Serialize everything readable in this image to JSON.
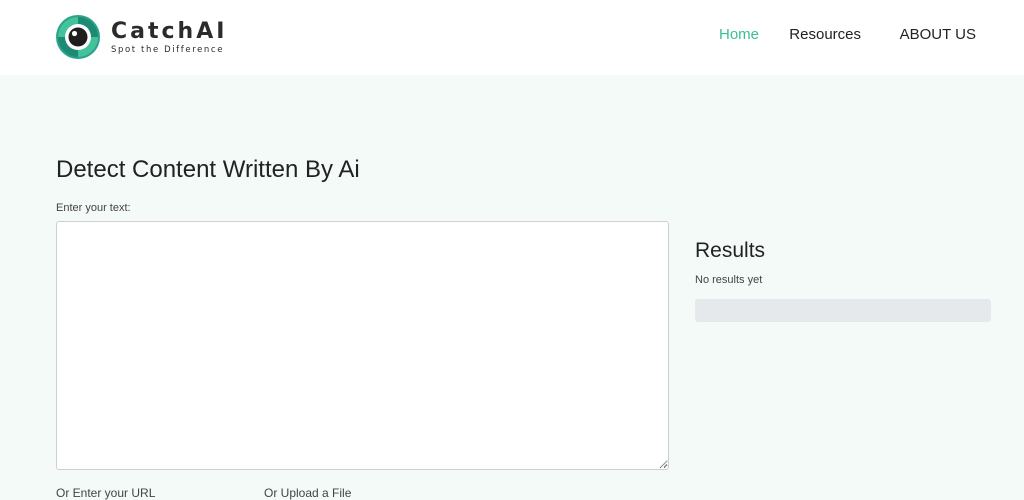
{
  "brand": {
    "name": "CatchAI",
    "tagline": "Spot the Difference",
    "color": "#2aa38a"
  },
  "nav": {
    "items": [
      {
        "label": "Home",
        "active": true
      },
      {
        "label": "Resources",
        "active": false
      },
      {
        "label": "ABOUT US",
        "active": false
      }
    ],
    "active_color": "#3cbf8f"
  },
  "main": {
    "title": "Detect Content Written By Ai",
    "text_label": "Enter your text:",
    "text_value": "",
    "url_label": "Or Enter your URL",
    "upload_label": "Or Upload a File"
  },
  "results": {
    "title": "Results",
    "status": "No results yet",
    "progress": 0
  },
  "icons": {
    "logo": "camera-lens-eye-icon",
    "textarea_grip": "resize-grip-icon"
  }
}
